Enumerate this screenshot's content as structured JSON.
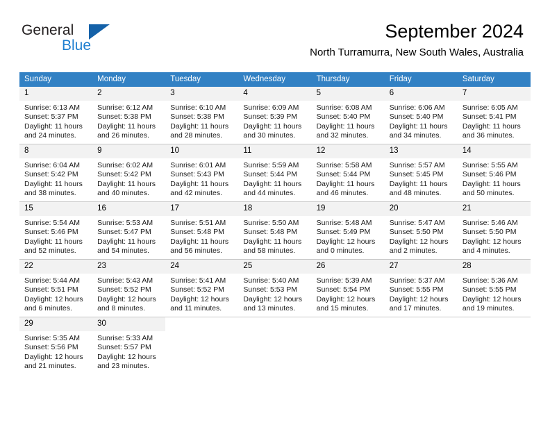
{
  "brand": {
    "name_top": "General",
    "name_bottom": "Blue",
    "logo_color": "#1461a8",
    "blue_text_color": "#1f7fd0"
  },
  "header": {
    "title": "September 2024",
    "subtitle": "North Turramurra, New South Wales, Australia"
  },
  "theme": {
    "header_row_bg": "#3281c4",
    "header_row_text": "#ffffff",
    "daynum_bg": "#f2f2f2",
    "row_divider": "#c8c8c8"
  },
  "weekday_headers": [
    "Sunday",
    "Monday",
    "Tuesday",
    "Wednesday",
    "Thursday",
    "Friday",
    "Saturday"
  ],
  "labels": {
    "sunrise_prefix": "Sunrise:",
    "sunset_prefix": "Sunset:",
    "daylight_prefix": "Daylight:"
  },
  "weeks": [
    [
      {
        "day": "1",
        "sunrise": "Sunrise: 6:13 AM",
        "sunset": "Sunset: 5:37 PM",
        "daylight_1": "Daylight: 11 hours",
        "daylight_2": "and 24 minutes."
      },
      {
        "day": "2",
        "sunrise": "Sunrise: 6:12 AM",
        "sunset": "Sunset: 5:38 PM",
        "daylight_1": "Daylight: 11 hours",
        "daylight_2": "and 26 minutes."
      },
      {
        "day": "3",
        "sunrise": "Sunrise: 6:10 AM",
        "sunset": "Sunset: 5:38 PM",
        "daylight_1": "Daylight: 11 hours",
        "daylight_2": "and 28 minutes."
      },
      {
        "day": "4",
        "sunrise": "Sunrise: 6:09 AM",
        "sunset": "Sunset: 5:39 PM",
        "daylight_1": "Daylight: 11 hours",
        "daylight_2": "and 30 minutes."
      },
      {
        "day": "5",
        "sunrise": "Sunrise: 6:08 AM",
        "sunset": "Sunset: 5:40 PM",
        "daylight_1": "Daylight: 11 hours",
        "daylight_2": "and 32 minutes."
      },
      {
        "day": "6",
        "sunrise": "Sunrise: 6:06 AM",
        "sunset": "Sunset: 5:40 PM",
        "daylight_1": "Daylight: 11 hours",
        "daylight_2": "and 34 minutes."
      },
      {
        "day": "7",
        "sunrise": "Sunrise: 6:05 AM",
        "sunset": "Sunset: 5:41 PM",
        "daylight_1": "Daylight: 11 hours",
        "daylight_2": "and 36 minutes."
      }
    ],
    [
      {
        "day": "8",
        "sunrise": "Sunrise: 6:04 AM",
        "sunset": "Sunset: 5:42 PM",
        "daylight_1": "Daylight: 11 hours",
        "daylight_2": "and 38 minutes."
      },
      {
        "day": "9",
        "sunrise": "Sunrise: 6:02 AM",
        "sunset": "Sunset: 5:42 PM",
        "daylight_1": "Daylight: 11 hours",
        "daylight_2": "and 40 minutes."
      },
      {
        "day": "10",
        "sunrise": "Sunrise: 6:01 AM",
        "sunset": "Sunset: 5:43 PM",
        "daylight_1": "Daylight: 11 hours",
        "daylight_2": "and 42 minutes."
      },
      {
        "day": "11",
        "sunrise": "Sunrise: 5:59 AM",
        "sunset": "Sunset: 5:44 PM",
        "daylight_1": "Daylight: 11 hours",
        "daylight_2": "and 44 minutes."
      },
      {
        "day": "12",
        "sunrise": "Sunrise: 5:58 AM",
        "sunset": "Sunset: 5:44 PM",
        "daylight_1": "Daylight: 11 hours",
        "daylight_2": "and 46 minutes."
      },
      {
        "day": "13",
        "sunrise": "Sunrise: 5:57 AM",
        "sunset": "Sunset: 5:45 PM",
        "daylight_1": "Daylight: 11 hours",
        "daylight_2": "and 48 minutes."
      },
      {
        "day": "14",
        "sunrise": "Sunrise: 5:55 AM",
        "sunset": "Sunset: 5:46 PM",
        "daylight_1": "Daylight: 11 hours",
        "daylight_2": "and 50 minutes."
      }
    ],
    [
      {
        "day": "15",
        "sunrise": "Sunrise: 5:54 AM",
        "sunset": "Sunset: 5:46 PM",
        "daylight_1": "Daylight: 11 hours",
        "daylight_2": "and 52 minutes."
      },
      {
        "day": "16",
        "sunrise": "Sunrise: 5:53 AM",
        "sunset": "Sunset: 5:47 PM",
        "daylight_1": "Daylight: 11 hours",
        "daylight_2": "and 54 minutes."
      },
      {
        "day": "17",
        "sunrise": "Sunrise: 5:51 AM",
        "sunset": "Sunset: 5:48 PM",
        "daylight_1": "Daylight: 11 hours",
        "daylight_2": "and 56 minutes."
      },
      {
        "day": "18",
        "sunrise": "Sunrise: 5:50 AM",
        "sunset": "Sunset: 5:48 PM",
        "daylight_1": "Daylight: 11 hours",
        "daylight_2": "and 58 minutes."
      },
      {
        "day": "19",
        "sunrise": "Sunrise: 5:48 AM",
        "sunset": "Sunset: 5:49 PM",
        "daylight_1": "Daylight: 12 hours",
        "daylight_2": "and 0 minutes."
      },
      {
        "day": "20",
        "sunrise": "Sunrise: 5:47 AM",
        "sunset": "Sunset: 5:50 PM",
        "daylight_1": "Daylight: 12 hours",
        "daylight_2": "and 2 minutes."
      },
      {
        "day": "21",
        "sunrise": "Sunrise: 5:46 AM",
        "sunset": "Sunset: 5:50 PM",
        "daylight_1": "Daylight: 12 hours",
        "daylight_2": "and 4 minutes."
      }
    ],
    [
      {
        "day": "22",
        "sunrise": "Sunrise: 5:44 AM",
        "sunset": "Sunset: 5:51 PM",
        "daylight_1": "Daylight: 12 hours",
        "daylight_2": "and 6 minutes."
      },
      {
        "day": "23",
        "sunrise": "Sunrise: 5:43 AM",
        "sunset": "Sunset: 5:52 PM",
        "daylight_1": "Daylight: 12 hours",
        "daylight_2": "and 8 minutes."
      },
      {
        "day": "24",
        "sunrise": "Sunrise: 5:41 AM",
        "sunset": "Sunset: 5:52 PM",
        "daylight_1": "Daylight: 12 hours",
        "daylight_2": "and 11 minutes."
      },
      {
        "day": "25",
        "sunrise": "Sunrise: 5:40 AM",
        "sunset": "Sunset: 5:53 PM",
        "daylight_1": "Daylight: 12 hours",
        "daylight_2": "and 13 minutes."
      },
      {
        "day": "26",
        "sunrise": "Sunrise: 5:39 AM",
        "sunset": "Sunset: 5:54 PM",
        "daylight_1": "Daylight: 12 hours",
        "daylight_2": "and 15 minutes."
      },
      {
        "day": "27",
        "sunrise": "Sunrise: 5:37 AM",
        "sunset": "Sunset: 5:55 PM",
        "daylight_1": "Daylight: 12 hours",
        "daylight_2": "and 17 minutes."
      },
      {
        "day": "28",
        "sunrise": "Sunrise: 5:36 AM",
        "sunset": "Sunset: 5:55 PM",
        "daylight_1": "Daylight: 12 hours",
        "daylight_2": "and 19 minutes."
      }
    ],
    [
      {
        "day": "29",
        "sunrise": "Sunrise: 5:35 AM",
        "sunset": "Sunset: 5:56 PM",
        "daylight_1": "Daylight: 12 hours",
        "daylight_2": "and 21 minutes."
      },
      {
        "day": "30",
        "sunrise": "Sunrise: 5:33 AM",
        "sunset": "Sunset: 5:57 PM",
        "daylight_1": "Daylight: 12 hours",
        "daylight_2": "and 23 minutes."
      },
      {
        "day": "",
        "sunrise": "",
        "sunset": "",
        "daylight_1": "",
        "daylight_2": ""
      },
      {
        "day": "",
        "sunrise": "",
        "sunset": "",
        "daylight_1": "",
        "daylight_2": ""
      },
      {
        "day": "",
        "sunrise": "",
        "sunset": "",
        "daylight_1": "",
        "daylight_2": ""
      },
      {
        "day": "",
        "sunrise": "",
        "sunset": "",
        "daylight_1": "",
        "daylight_2": ""
      },
      {
        "day": "",
        "sunrise": "",
        "sunset": "",
        "daylight_1": "",
        "daylight_2": ""
      }
    ]
  ]
}
